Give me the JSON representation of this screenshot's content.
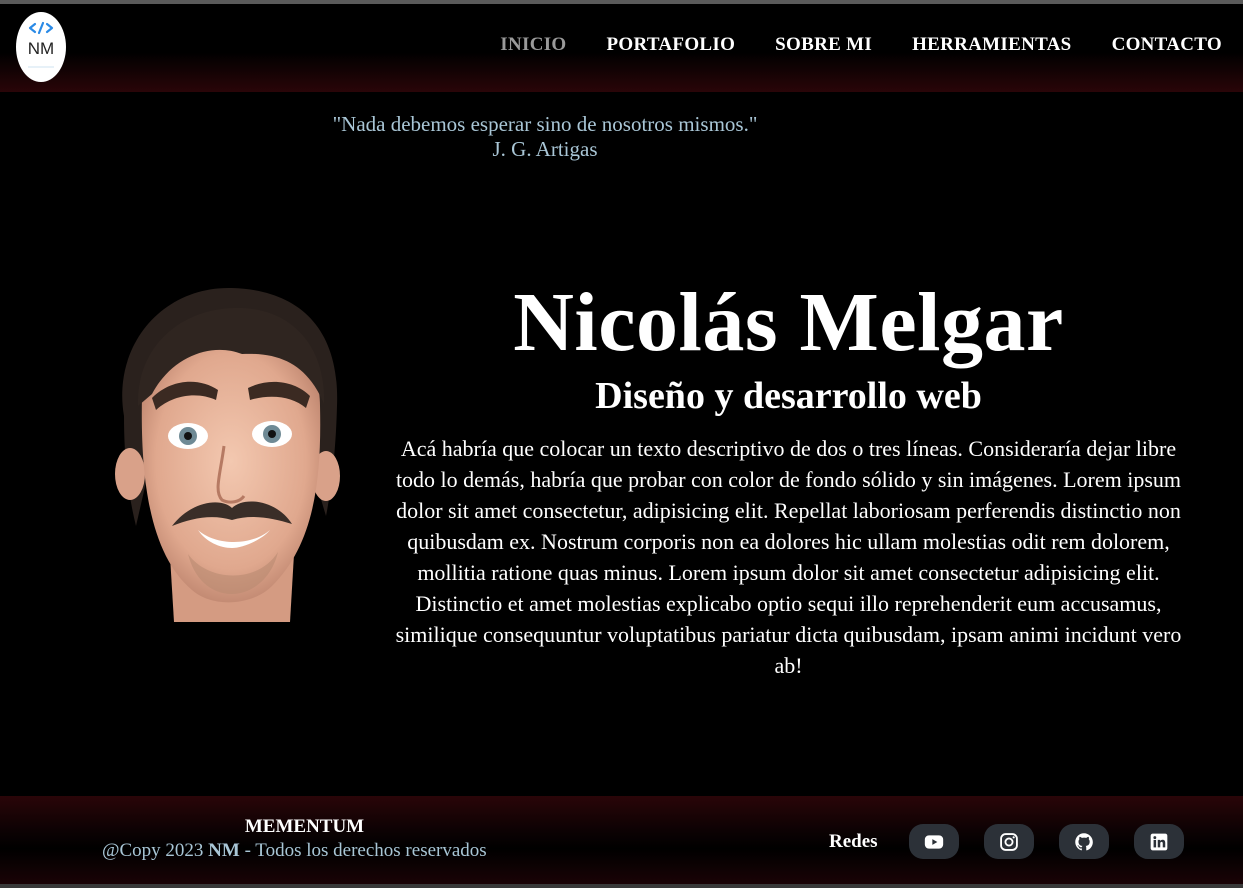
{
  "logo": {
    "text": "NM",
    "icon": "code-brackets-icon",
    "accent": "#2a8ae6"
  },
  "nav": {
    "items": [
      {
        "label": "INICIO",
        "active": true
      },
      {
        "label": "PORTAFOLIO",
        "active": false
      },
      {
        "label": "SOBRE MI",
        "active": false
      },
      {
        "label": "HERRAMIENTAS",
        "active": false
      },
      {
        "label": "CONTACTO",
        "active": false
      }
    ]
  },
  "quote": {
    "text": "\"Nada debemos esperar sino de nosotros mismos.\"",
    "author": "J. G. Artigas"
  },
  "hero": {
    "name": "Nicolás Melgar",
    "subtitle": "Diseño y desarrollo web",
    "description": "Acá habría que colocar un texto descriptivo de dos o tres líneas. Consideraría dejar libre todo lo demás, habría que probar con color de fondo sólido y sin imágenes. Lorem ipsum dolor sit amet consectetur, adipisicing elit. Repellat laboriosam perferendis distinctio non quibusdam ex. Nostrum corporis non ea dolores hic ullam molestias odit rem dolorem, mollitia ratione quas minus. Lorem ipsum dolor sit amet consectetur adipisicing elit. Distinctio et amet molestias explicabo optio sequi illo reprehenderit eum accusamus, similique consequuntur voluptatibus pariatur dicta quibusdam, ipsam animi incidunt vero ab!"
  },
  "footer": {
    "brand": "MEMENTUM",
    "copy_prefix": "@Copy 2023 ",
    "copy_name": "NM",
    "copy_suffix": " - Todos los derechos reservados",
    "redes_label": "Redes",
    "socials": [
      {
        "name": "youtube",
        "icon": "youtube-icon"
      },
      {
        "name": "instagram",
        "icon": "instagram-icon"
      },
      {
        "name": "github",
        "icon": "github-icon"
      },
      {
        "name": "linkedin",
        "icon": "linkedin-icon"
      }
    ]
  },
  "colors": {
    "background": "#000000",
    "quote_text": "#a9c6d6",
    "active_nav": "#9a9a9a",
    "social_button": "#2c3138",
    "gradient_red": "#2a0508"
  }
}
